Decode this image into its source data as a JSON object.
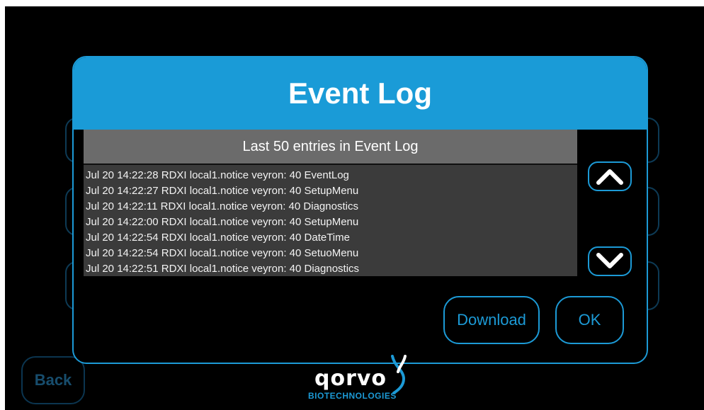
{
  "modal": {
    "title": "Event Log",
    "log_header": "Last 50 entries in Event Log",
    "entries": [
      "Jul 20 14:22:28 RDXI local1.notice veyron: 40 EventLog",
      "Jul 20 14:22:27 RDXI local1.notice veyron: 40 SetupMenu",
      "Jul 20 14:22:11 RDXI local1.notice veyron: 40 Diagnostics",
      "Jul 20 14:22:00 RDXI local1.notice veyron: 40 SetupMenu",
      "Jul 20 14:22:54 RDXI local1.notice veyron: 40 DateTime",
      "Jul 20 14:22:54 RDXI local1.notice veyron: 40 SetuoMenu",
      "Jul 20 14:22:51 RDXI local1.notice veyron: 40 Diagnostics"
    ],
    "scroll_up_icon": "chevron-up-icon",
    "scroll_down_icon": "chevron-down-icon",
    "download_label": "Download",
    "ok_label": "OK"
  },
  "background": {
    "back_label": "Back"
  },
  "logo": {
    "name": "qorvo",
    "subtitle": "BIOTECHNOLOGIES"
  },
  "colors": {
    "accent": "#1a9bd7",
    "log_header_bg": "#6b6b6b",
    "log_body_bg": "#3b3b3b",
    "background": "#000000"
  }
}
